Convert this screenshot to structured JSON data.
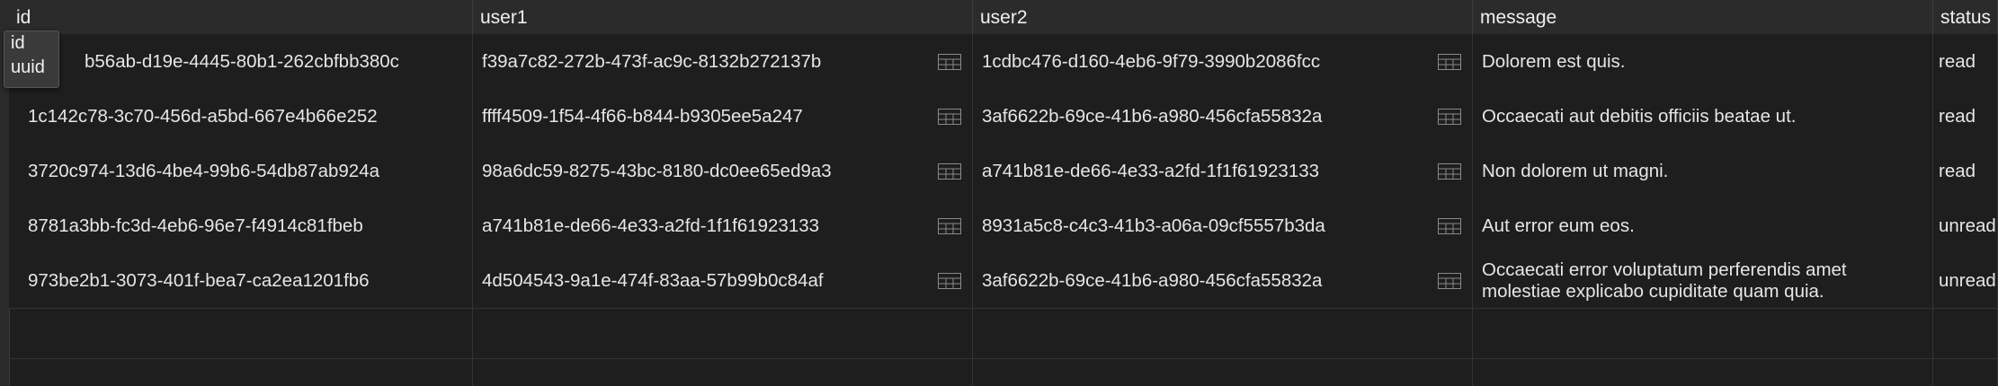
{
  "table": {
    "columns": [
      {
        "key": "id",
        "label": "id"
      },
      {
        "key": "user1",
        "label": "user1"
      },
      {
        "key": "user2",
        "label": "user2"
      },
      {
        "key": "message",
        "label": "message"
      },
      {
        "key": "status",
        "label": "status"
      }
    ],
    "rows": [
      {
        "id": "b56ab-d19e-4445-80b1-262cbfbb380c",
        "user1": "f39a7c82-272b-473f-ac9c-8132b272137b",
        "user2": "1cdbc476-d160-4eb6-9f79-3990b2086fcc",
        "message": "Dolorem est quis.",
        "status": "read"
      },
      {
        "id": "1c142c78-3c70-456d-a5bd-667e4b66e252",
        "user1": "ffff4509-1f54-4f66-b844-b9305ee5a247",
        "user2": "3af6622b-69ce-41b6-a980-456cfa55832a",
        "message": "Occaecati aut debitis officiis beatae ut.",
        "status": "read"
      },
      {
        "id": "3720c974-13d6-4be4-99b6-54db87ab924a",
        "user1": "98a6dc59-8275-43bc-8180-dc0ee65ed9a3",
        "user2": "a741b81e-de66-4e33-a2fd-1f1f61923133",
        "message": "Non dolorem ut magni.",
        "status": "read"
      },
      {
        "id": "8781a3bb-fc3d-4eb6-96e7-f4914c81fbeb",
        "user1": "a741b81e-de66-4e33-a2fd-1f1f61923133",
        "user2": "8931a5c8-c4c3-41b3-a06a-09cf5557b3da",
        "message": "Aut error eum eos.",
        "status": "unread"
      },
      {
        "id": "973be2b1-3073-401f-bea7-ca2ea1201fb6",
        "user1": "4d504543-9a1e-474f-83aa-57b99b0c84af",
        "user2": "3af6622b-69ce-41b6-a980-456cfa55832a",
        "message": "Occaecati error voluptatum perferendis amet molestiae explicabo cupiditate quam quia.",
        "status": "unread"
      }
    ]
  },
  "tooltip": {
    "name": "id",
    "type": "uuid"
  },
  "icons": {
    "foreign_key": "table-grid-icon"
  },
  "colors": {
    "background": "#1e1e1e",
    "header": "#2b2b2b",
    "text": "#e6e6e6",
    "grid": "#333333"
  }
}
